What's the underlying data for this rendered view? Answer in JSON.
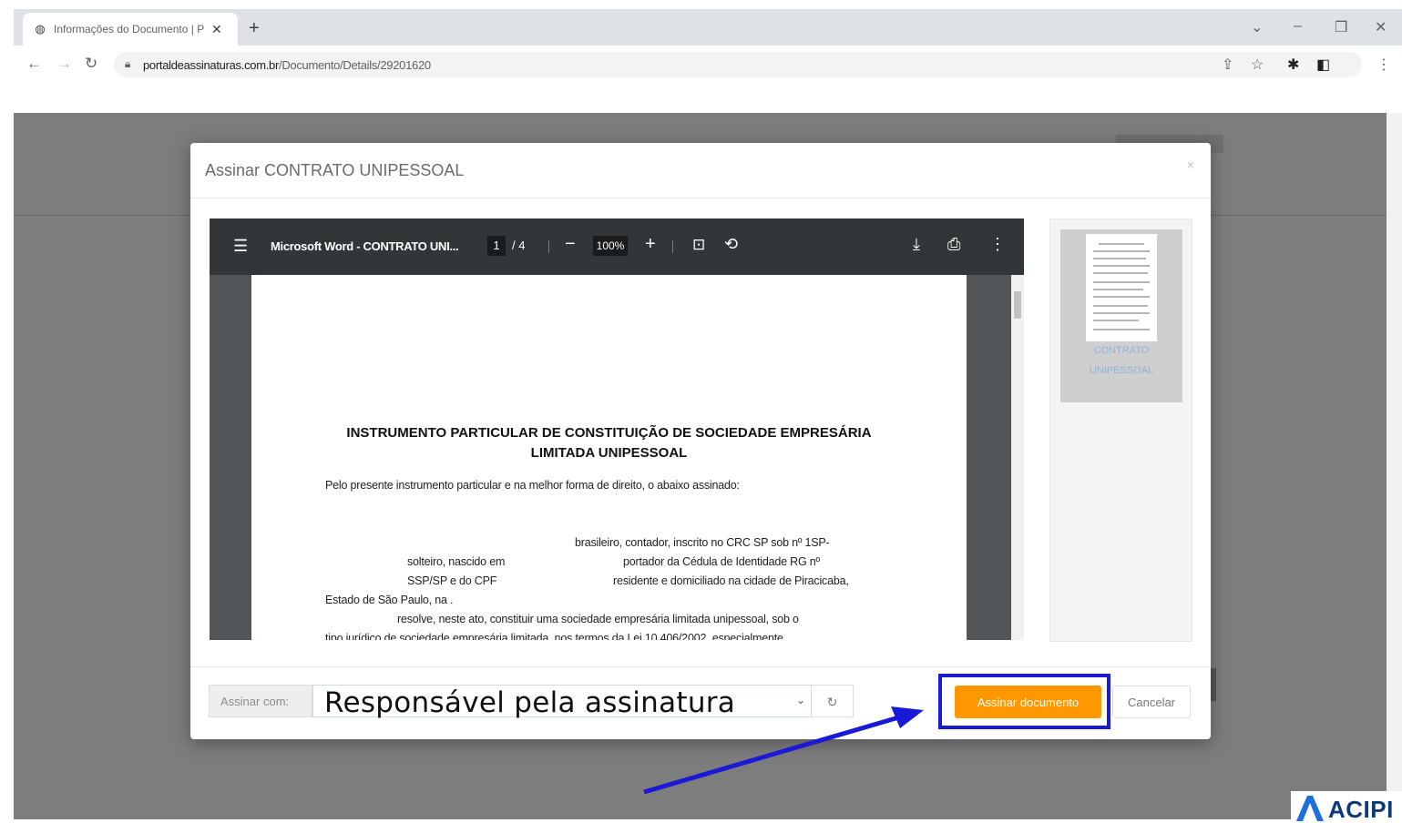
{
  "browser": {
    "tab_title": "Informações do Documento | Po",
    "tab_close": "✕",
    "new_tab": "+",
    "url_host": "portaldeassinaturas.com.br",
    "url_path": "/Documento/Details/29201620"
  },
  "modal": {
    "title": "Assinar CONTRATO UNIPESSOAL",
    "close": "×"
  },
  "pdf_viewer": {
    "doc_name": "Microsoft Word - CONTRATO UNI...",
    "page_current": "1",
    "page_total": "/ 4",
    "zoom": "100%"
  },
  "document": {
    "title_line1": "INSTRUMENTO PARTICULAR DE CONSTITUIÇÃO DE SOCIEDADE EMPRESÁRIA",
    "title_line2": "LIMITADA UNIPESSOAL",
    "intro": "Pelo presente instrumento particular e na melhor forma de direito, o abaixo assinado:",
    "l1": "brasileiro, contador, inscrito no CRC SP sob nº 1SP-",
    "l2a": "solteiro,  nascido  em",
    "l2b": "portador  da  Cédula  de  Identidade  RG  nº",
    "l3a": "SSP/SP e do CPF",
    "l3b": "residente e domiciliado na cidade de Piracicaba,",
    "l4": "Estado de São Paulo, na .",
    "l5": "resolve, neste ato, constituir uma sociedade empresária limitada unipessoal, sob o",
    "l6": "tipo jurídico de sociedade empresária limitada, nos termos da Lei 10.406/2002, especialmente"
  },
  "thumbnail": {
    "label_line1": "CONTRATO",
    "label_line2": "UNIPESSOAL"
  },
  "footer": {
    "sign_with_label": "Assinar com:",
    "selected_signer": "Responsável pela assinatura",
    "sign_button": "Assinar documento",
    "cancel_button": "Cancelar"
  },
  "watermark": {
    "logo_text": "ACIPI"
  },
  "colors": {
    "sign_button": "#ff9800",
    "highlight": "#1a1ad6",
    "overlay": "#7d7d7d"
  }
}
